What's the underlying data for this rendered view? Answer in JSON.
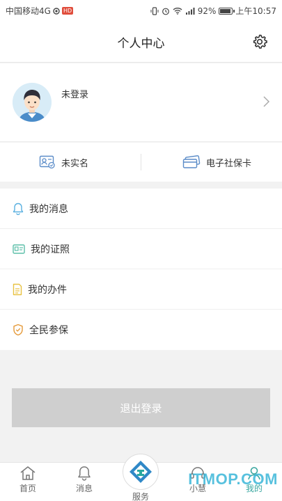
{
  "status_bar": {
    "carrier": "中国移动4G",
    "hd_badge": "HD",
    "battery": "92%",
    "battery_level": 0.92,
    "time": "上午10:57"
  },
  "header": {
    "title": "个人中心",
    "settings_icon": "gear-icon"
  },
  "profile": {
    "login_status": "未登录"
  },
  "id_row": {
    "real_name": "未实名",
    "social_card": "电子社保卡"
  },
  "menu": {
    "items": [
      {
        "label": "我的消息",
        "icon": "bell-icon",
        "color": "#5ab0e0"
      },
      {
        "label": "我的证照",
        "icon": "id-card-icon",
        "color": "#5cbfa9"
      },
      {
        "label": "我的办件",
        "icon": "document-icon",
        "color": "#e8c242"
      },
      {
        "label": "全民参保",
        "icon": "shield-icon",
        "color": "#e59a3a"
      }
    ]
  },
  "logout": {
    "label": "退出登录"
  },
  "tabbar": {
    "tabs": [
      {
        "label": "首页",
        "icon": "home-icon"
      },
      {
        "label": "消息",
        "icon": "bell-icon"
      },
      {
        "label": "服务",
        "icon": "service-logo-icon"
      },
      {
        "label": "小慧",
        "icon": "assistant-icon"
      },
      {
        "label": "我的",
        "icon": "user-icon"
      }
    ],
    "active_color": "#3aa7a0"
  },
  "watermark": "ITMOP.COM"
}
